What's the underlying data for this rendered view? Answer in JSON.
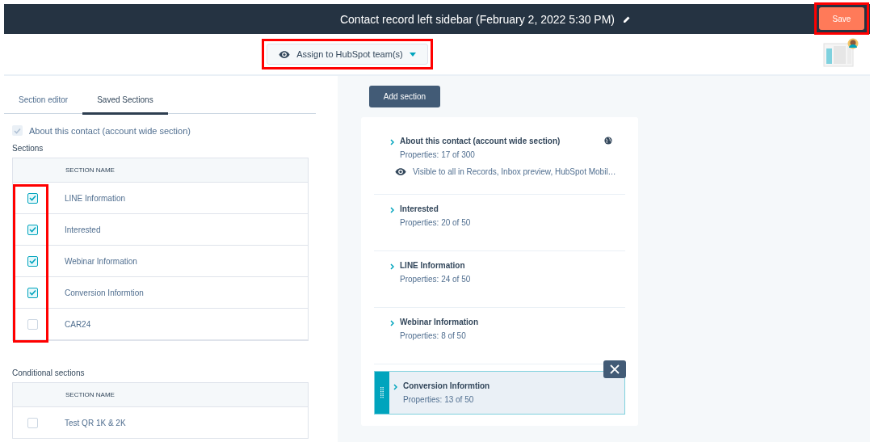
{
  "header": {
    "title": "Contact record left sidebar (February 2, 2022 5:30 PM)",
    "save_button": {
      "label": "Save",
      "highlighted": true
    }
  },
  "team_dropdown": {
    "label": "Assign to HubSpot team(s)",
    "highlighted": true
  },
  "left_panel": {
    "tabs": [
      {
        "label": "Section editor",
        "selected": false
      },
      {
        "label": "Saved Sections",
        "selected": true
      }
    ],
    "account_wide": {
      "label": "About this contact (account wide section)",
      "checked": true,
      "disabled": true
    },
    "tables": [
      {
        "title": "Sections",
        "column": "SECTION NAME",
        "highlighted": true,
        "rows": [
          {
            "name": "LINE Information",
            "checked": true
          },
          {
            "name": "Interested",
            "checked": true
          },
          {
            "name": "Webinar Information",
            "checked": true
          },
          {
            "name": "Conversion Informtion",
            "checked": true
          },
          {
            "name": "CAR24",
            "checked": false
          }
        ]
      },
      {
        "title": "Conditional sections",
        "column": "SECTION NAME",
        "highlighted": false,
        "rows": [
          {
            "name": "Test QR 1K & 2K",
            "checked": false
          }
        ]
      }
    ]
  },
  "right_panel": {
    "add_button": "Add section",
    "cards": [
      {
        "title": "About this contact (account wide section)",
        "properties": "Properties: 17 of 300",
        "visibility": "Visible to all in Records, Inbox preview, HubSpot Mobil…",
        "account_wide": true,
        "selected": false
      },
      {
        "title": "Interested",
        "properties": "Properties: 20 of 50",
        "account_wide": false,
        "selected": false
      },
      {
        "title": "LINE Information",
        "properties": "Properties: 24 of 50",
        "account_wide": false,
        "selected": false
      },
      {
        "title": "Webinar Information",
        "properties": "Properties: 8 of 50",
        "account_wide": false,
        "selected": false
      },
      {
        "title": "Conversion Informtion",
        "properties": "Properties: 13 of 50",
        "account_wide": false,
        "selected": true
      }
    ]
  }
}
